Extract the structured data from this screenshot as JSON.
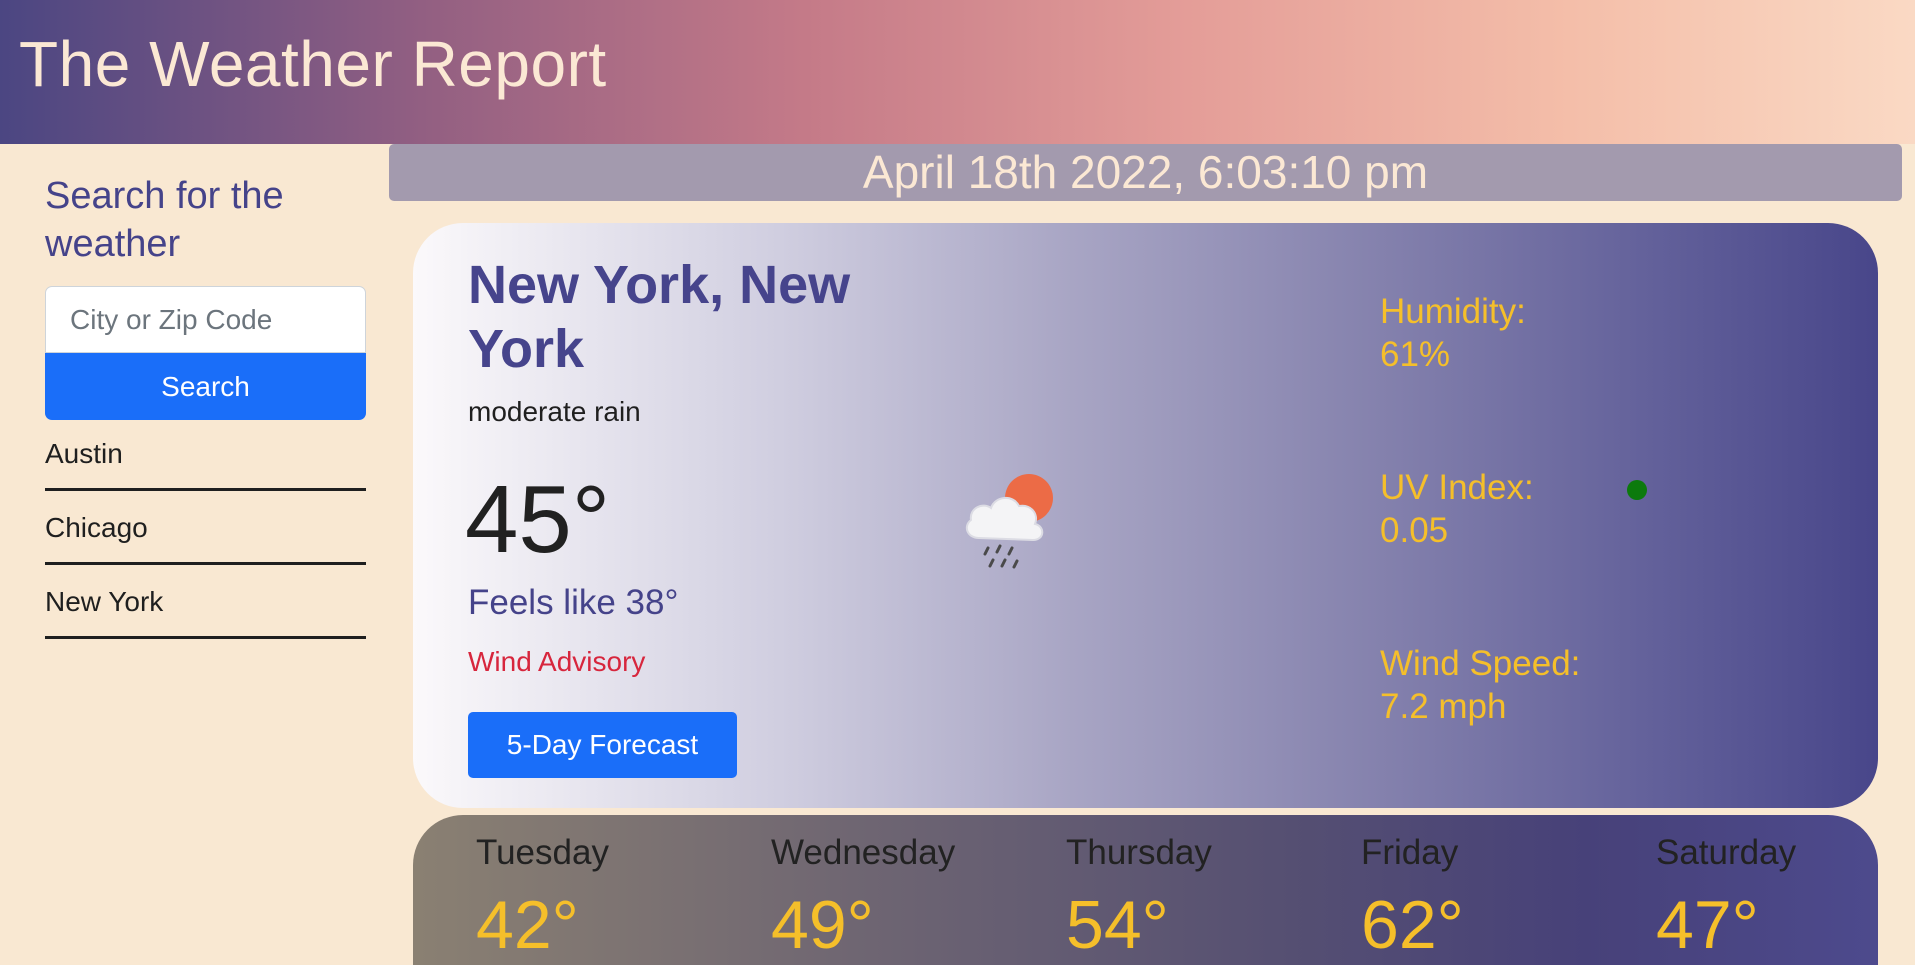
{
  "header": {
    "title": "The Weather Report"
  },
  "sidebar": {
    "title": "Search for the weather",
    "search_placeholder": "City or Zip Code",
    "search_button_label": "Search",
    "history": [
      {
        "label": "Austin"
      },
      {
        "label": "Chicago"
      },
      {
        "label": "New York"
      }
    ]
  },
  "datetime": "April 18th 2022, 6:03:10 pm",
  "current": {
    "city": "New York, New York",
    "condition": "moderate rain",
    "temperature": "45°",
    "feels_like": "Feels like 38°",
    "advisory": "Wind Advisory",
    "forecast_button_label": "5-Day Forecast",
    "icon": "cloud-rain-sun-icon",
    "humidity_label": "Humidity:",
    "humidity_value": "61%",
    "uv_label": "UV Index:",
    "uv_value": "0.05",
    "uv_indicator_color": "#0c7a0c",
    "wind_label": "Wind Speed:",
    "wind_value": "7.2 mph"
  },
  "forecast": [
    {
      "day": "Tuesday",
      "temp": "42°"
    },
    {
      "day": "Wednesday",
      "temp": "49°"
    },
    {
      "day": "Thursday",
      "temp": "54°"
    },
    {
      "day": "Friday",
      "temp": "62°"
    },
    {
      "day": "Saturday",
      "temp": "47°"
    }
  ],
  "colors": {
    "background": "#f9e8d2",
    "primary_button": "#1a6ef9",
    "accent_text": "#45438a",
    "stat_text": "#f5bf2a",
    "advisory": "#d7263d"
  }
}
